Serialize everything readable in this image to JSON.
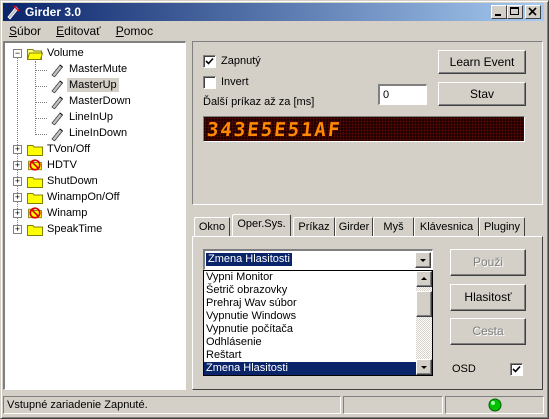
{
  "window": {
    "title": "Girder 3.0"
  },
  "menu": [
    {
      "label": "Súbor",
      "ul": "S",
      "rest": "úbor"
    },
    {
      "label": "Editovať",
      "ul": "E",
      "rest": "ditovať"
    },
    {
      "label": "Pomoc",
      "ul": "P",
      "rest": "omoc"
    }
  ],
  "tree": {
    "root": {
      "label": "Volume",
      "expanded": true
    },
    "children": [
      {
        "label": "MasterMute",
        "selected": false
      },
      {
        "label": "MasterUp",
        "selected": true
      },
      {
        "label": "MasterDown",
        "selected": false
      },
      {
        "label": "LineInUp",
        "selected": false
      },
      {
        "label": "LineInDown",
        "selected": false
      }
    ],
    "groups": [
      {
        "label": "TVon/Off",
        "icon": "folder-icon"
      },
      {
        "label": "HDTV",
        "icon": "disabled-folder-icon"
      },
      {
        "label": "ShutDown",
        "icon": "folder-icon"
      },
      {
        "label": "WinampOn/Off",
        "icon": "folder-icon"
      },
      {
        "label": "Winamp",
        "icon": "disabled-folder-icon"
      },
      {
        "label": "SpeakTime",
        "icon": "folder-icon"
      }
    ]
  },
  "event": {
    "enabled_label": "Zapnutý",
    "enabled": true,
    "invert_label": "Invert",
    "invert": false,
    "delay_label": "Ďalší príkaz až za [ms]",
    "delay_value": "0",
    "learn_button": "Learn Event",
    "status_button": "Stav",
    "led_display": "343E5E51AF"
  },
  "tabs": [
    "Okno",
    "Oper.Sys.",
    "Príkaz",
    "Girder",
    "Myš",
    "Klávesnica",
    "Pluginy"
  ],
  "active_tab": "Oper.Sys.",
  "os": {
    "selected": "Zmena Hlasitosti",
    "options": [
      "Vypni Monitor",
      "Šetrič obrazovky",
      "Prehraj Wav súbor",
      "Vypnutie Windows",
      "Vypnutie počítača",
      "Odhlásenie",
      "Reštart",
      "Zmena Hlasitosti"
    ],
    "use_button": "Použi",
    "volume_button": "Hlasitosť",
    "path_button": "Cesta",
    "osd_label": "OSD",
    "osd": true
  },
  "statusbar": {
    "text": "Vstupné zariadenie Zapnuté.",
    "led_color": "#00c000"
  }
}
